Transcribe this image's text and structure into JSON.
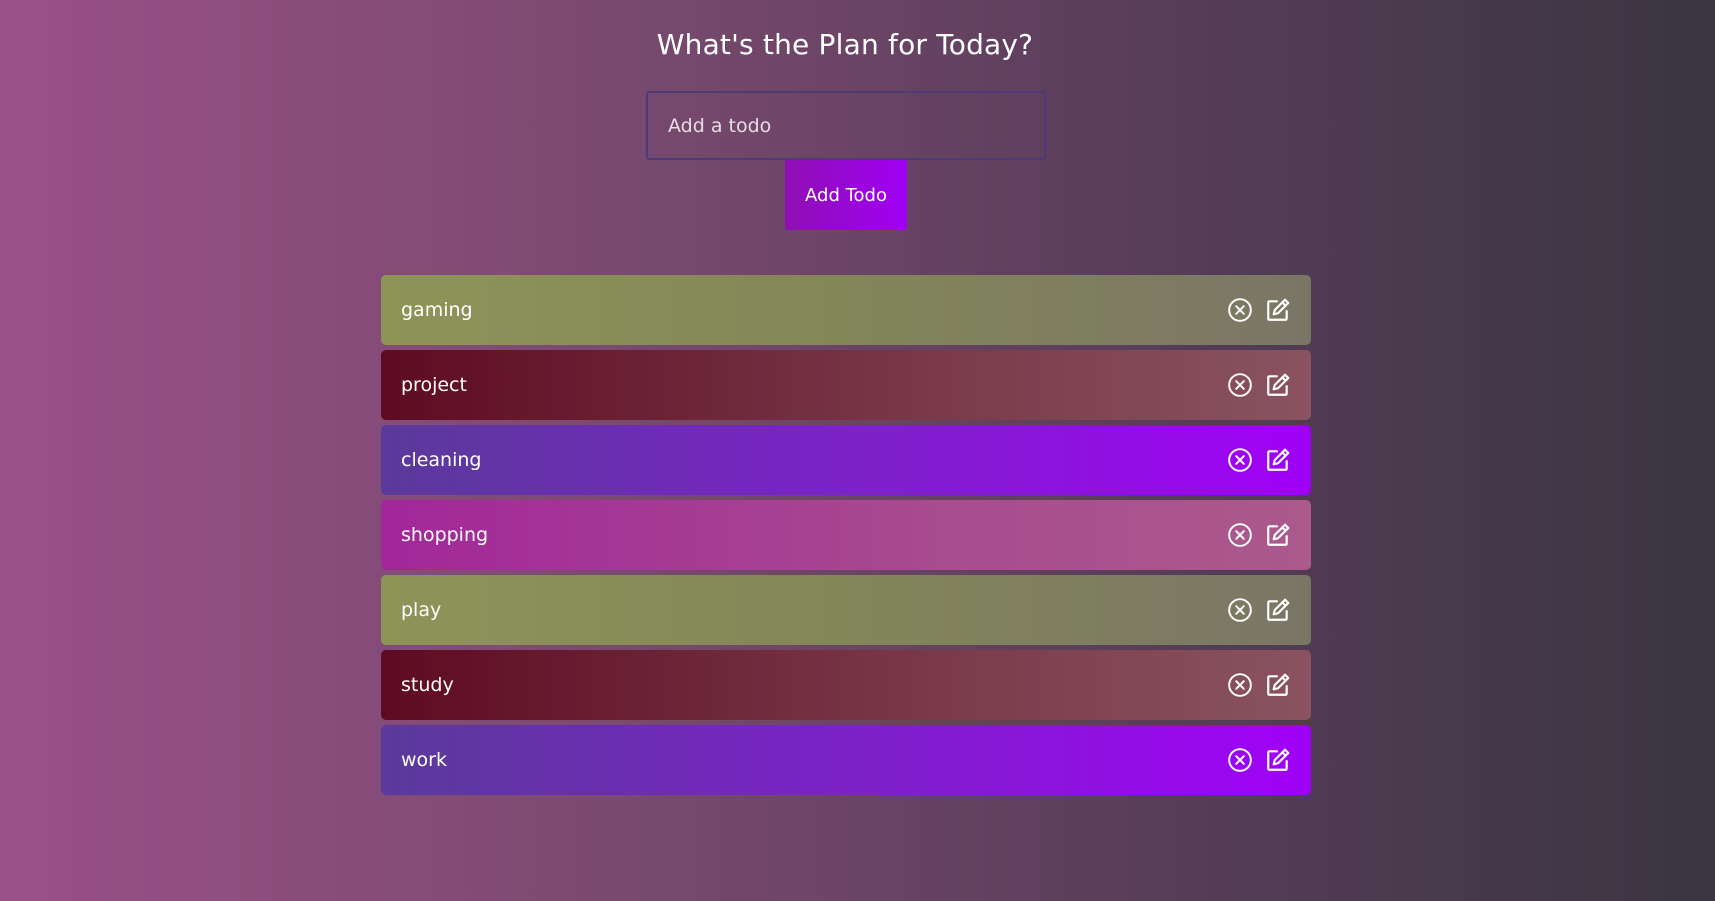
{
  "header": {
    "title": "What's the Plan for Today?"
  },
  "form": {
    "placeholder": "Add a todo",
    "value": "",
    "button_label": "Add Todo"
  },
  "todos": [
    {
      "text": "gaming",
      "color": "olive"
    },
    {
      "text": "project",
      "color": "maroon"
    },
    {
      "text": "cleaning",
      "color": "violet"
    },
    {
      "text": "shopping",
      "color": "pink"
    },
    {
      "text": "play",
      "color": "olive"
    },
    {
      "text": "study",
      "color": "maroon"
    },
    {
      "text": "work",
      "color": "violet"
    }
  ],
  "icons": {
    "delete": "close-circle-icon",
    "edit": "edit-icon"
  },
  "colors": {
    "olive": "#8d9458",
    "maroon": "#5e0b22",
    "violet": "#a100f8",
    "pink": "#a2279a",
    "button": "#a100f5"
  }
}
